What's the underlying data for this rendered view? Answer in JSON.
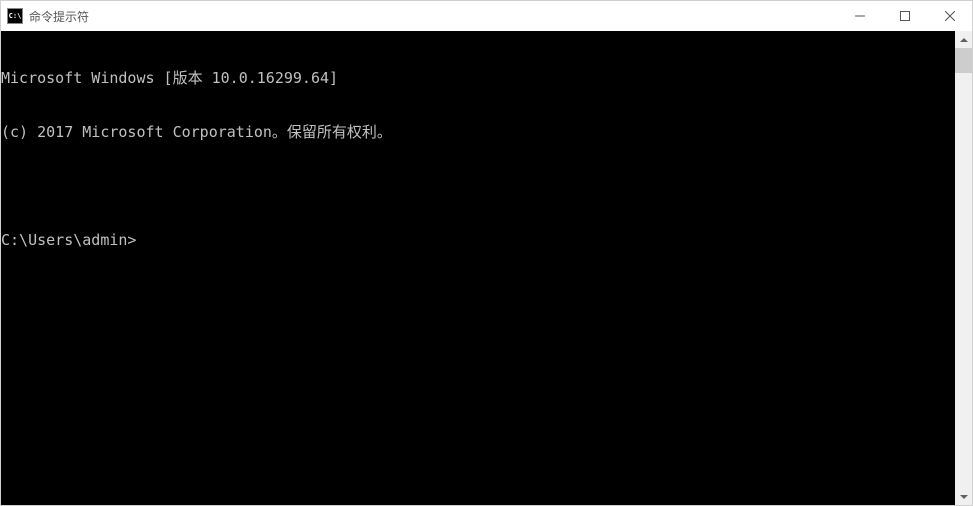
{
  "titlebar": {
    "icon_label": "C:\\",
    "title": "命令提示符"
  },
  "terminal": {
    "line1": "Microsoft Windows [版本 10.0.16299.64]",
    "line2": "(c) 2017 Microsoft Corporation。保留所有权利。",
    "blank": "",
    "prompt": "C:\\Users\\admin>"
  }
}
